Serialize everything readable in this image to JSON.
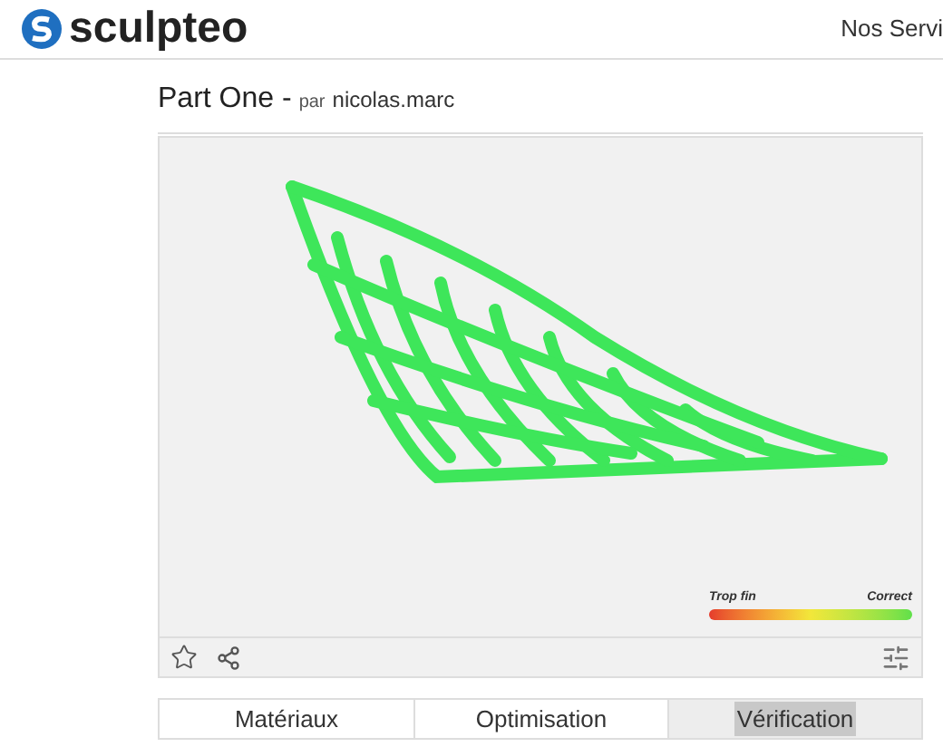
{
  "header": {
    "logo": "sculpteo",
    "nav_item": "Nos Servi"
  },
  "title": {
    "name": "Part One -",
    "by": "par",
    "author": "nicolas.marc"
  },
  "legend": {
    "low": "Trop fin",
    "high": "Correct"
  },
  "tabs": [
    {
      "label": "Matériaux",
      "selected": false
    },
    {
      "label": "Optimisation",
      "selected": false
    },
    {
      "label": "Vérification",
      "selected": true
    }
  ]
}
